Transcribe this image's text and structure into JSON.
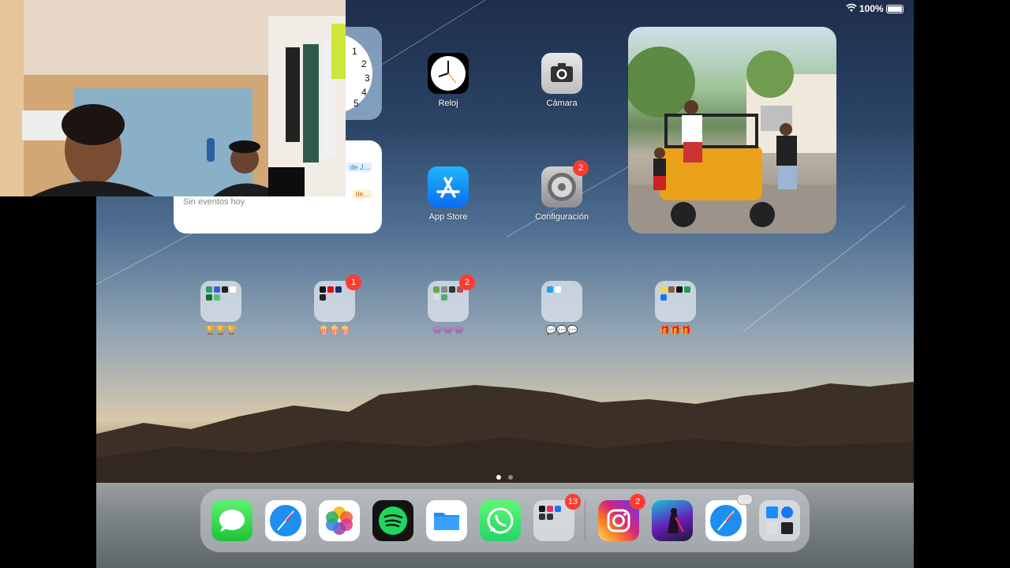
{
  "status_bar": {
    "battery": "100%"
  },
  "widgets": {
    "clock_numbers": [
      "1",
      "2",
      "3",
      "4",
      "5"
    ],
    "calendar": {
      "event1": "de J...",
      "event2": "de...",
      "empty_text": "Sin eventos hoy"
    }
  },
  "apps": {
    "clock": "Reloj",
    "camera": "Cámara",
    "app_store": "App Store",
    "settings": "Configuración",
    "settings_badge": "2"
  },
  "folders": [
    {
      "label": "🏆🏆🏆",
      "badge": ""
    },
    {
      "label": "🍿🍿🍿",
      "badge": "1"
    },
    {
      "label": "👾👾👾",
      "badge": "2"
    },
    {
      "label": "💬💬💬",
      "badge": ""
    },
    {
      "label": "🎁🎁🎁",
      "badge": ""
    }
  ],
  "dock": {
    "folder_badge": "13",
    "instagram_badge": "2"
  }
}
